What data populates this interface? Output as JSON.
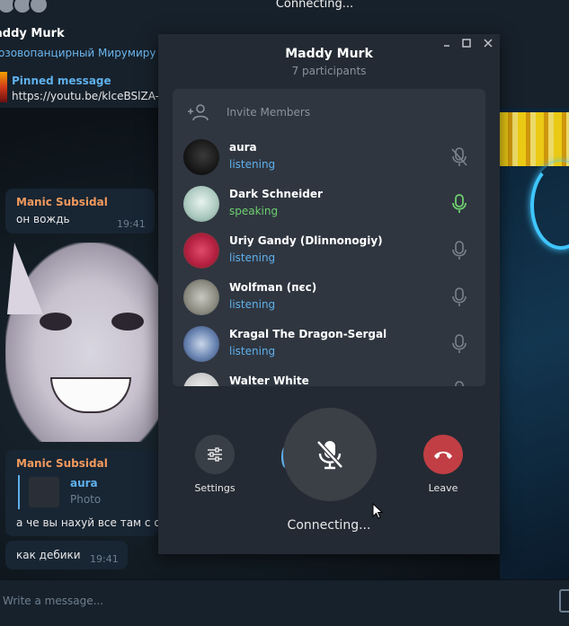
{
  "window": {
    "title": "Connecting..."
  },
  "chat": {
    "name": "addy Murk",
    "subtitle": "озовопанцирный Мирумиру",
    "pinned": {
      "label": "Pinned message",
      "text": "https://youtu.be/klceBSlZA-"
    },
    "messages": [
      {
        "author": "Manic Subsidal",
        "text": "он вождь",
        "time": "19:41"
      },
      {
        "author": "Manic Subsidal",
        "quote_author": "aura",
        "quote_type": "Photo",
        "text": "а че вы нахуй все там с ос"
      },
      {
        "text": "как дебики",
        "time": "19:41"
      }
    ],
    "composer_placeholder": "Write a message..."
  },
  "call": {
    "title": "Maddy Murk",
    "participants": "7 participants",
    "invite_label": "Invite Members",
    "members": [
      {
        "name": "aura",
        "status": "listening",
        "mic": "muted-icon"
      },
      {
        "name": "Dark Schneider",
        "status": "speaking",
        "mic": "mic-active-icon"
      },
      {
        "name": "Uriy Gandy (Dlinnonogiy)",
        "status": "listening",
        "mic": "mic-icon"
      },
      {
        "name": "Wolfman (пєс)",
        "status": "listening",
        "mic": "mic-icon"
      },
      {
        "name": "Kragal The Dragon-Sergal",
        "status": "listening",
        "mic": "mic-icon"
      },
      {
        "name": "Walter White",
        "status": "",
        "mic": "mic-icon"
      }
    ],
    "settings_label": "Settings",
    "leave_label": "Leave",
    "status": "Connecting..."
  },
  "colors": {
    "accent": "#5fb0ec",
    "speaking": "#6fcf6f",
    "leave": "#c13f44",
    "panel": "#242a33"
  }
}
